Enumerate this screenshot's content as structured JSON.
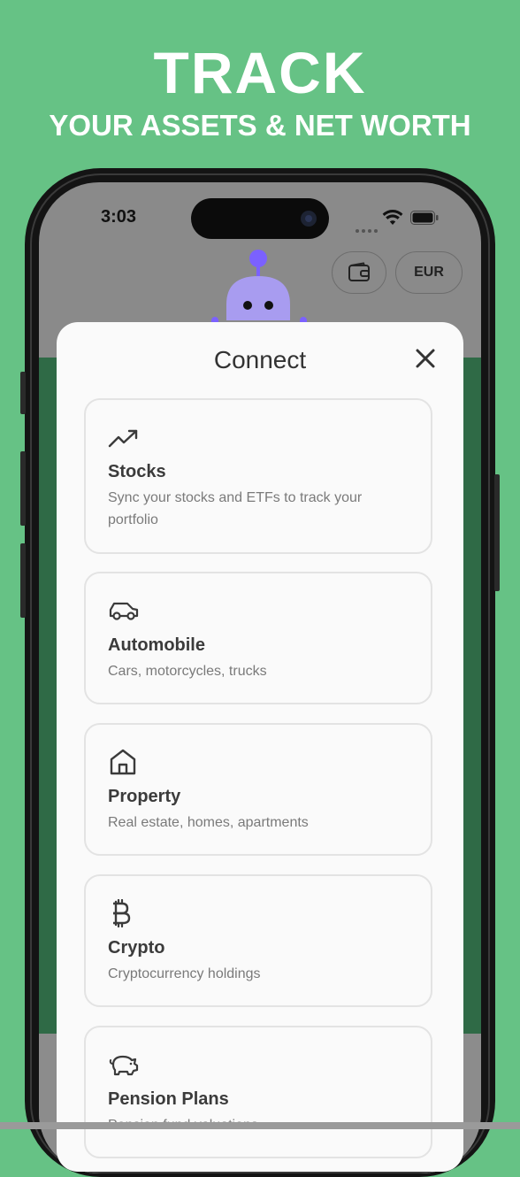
{
  "headline": {
    "title": "TRACK",
    "subtitle": "YOUR ASSETS & NET WORTH"
  },
  "status_bar": {
    "time": "3:03"
  },
  "top_bar": {
    "currency_label": "EUR",
    "wallet_icon": "wallet-icon"
  },
  "modal": {
    "title": "Connect",
    "close_icon": "close-icon",
    "cards": [
      {
        "title": "Stocks",
        "desc": "Sync your stocks and ETFs to track your portfolio",
        "icon": "trending-up-icon"
      },
      {
        "title": "Automobile",
        "desc": "Cars, motorcycles, trucks",
        "icon": "car-icon"
      },
      {
        "title": "Property",
        "desc": "Real estate, homes, apartments",
        "icon": "home-icon"
      },
      {
        "title": "Crypto",
        "desc": "Cryptocurrency holdings",
        "icon": "bitcoin-icon"
      },
      {
        "title": "Pension Plans",
        "desc": "Pension fund valuations",
        "icon": "piggy-bank-icon"
      }
    ]
  },
  "colors": {
    "background": "#66c285",
    "mascot": "#a89cf0",
    "mascot_accent": "#7b61ff"
  }
}
